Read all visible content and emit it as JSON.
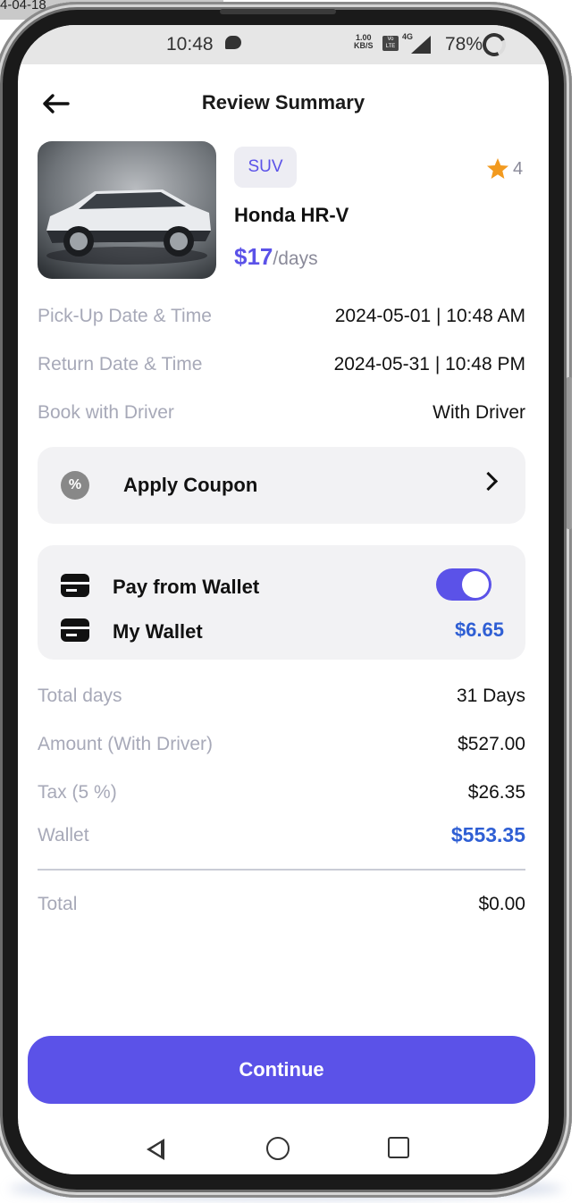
{
  "desktop": {
    "partial_text": "4-04-18"
  },
  "status_bar": {
    "time": "10:48",
    "net_speed_value": "1.00",
    "net_speed_unit": "KB/S",
    "volte": "Vo LTE",
    "network": "4G",
    "battery": "78%"
  },
  "header": {
    "title": "Review Summary",
    "back_icon": "arrow-left-icon"
  },
  "car": {
    "category": "SUV",
    "rating": "4",
    "name": "Honda HR-V",
    "price": "$17",
    "price_unit": "/days"
  },
  "details": [
    {
      "label": "Pick-Up Date & Time",
      "value": "2024-05-01 | 10:48 AM"
    },
    {
      "label": "Return Date & Time",
      "value": "2024-05-31 | 10:48 PM"
    },
    {
      "label": "Book with Driver",
      "value": "With Driver"
    }
  ],
  "coupon": {
    "label": "Apply Coupon",
    "icon": "percent-icon"
  },
  "wallet": {
    "pay_label": "Pay from Wallet",
    "pay_toggle_on": true,
    "my_wallet_label": "My Wallet",
    "balance": "$6.65"
  },
  "summary": [
    {
      "label": "Total days",
      "value": "31 Days"
    },
    {
      "label": "Amount (With Driver)",
      "value": "$527.00"
    },
    {
      "label": "Tax (5 %)",
      "value": "$26.35"
    },
    {
      "label": "Wallet",
      "value": "$553.35"
    }
  ],
  "total": {
    "label": "Total",
    "value": "$0.00"
  },
  "continue_label": "Continue",
  "colors": {
    "accent": "#5b52e8",
    "wallet_blue": "#2f5fd4",
    "muted": "#a7a9b8",
    "star": "#f29a1f"
  }
}
